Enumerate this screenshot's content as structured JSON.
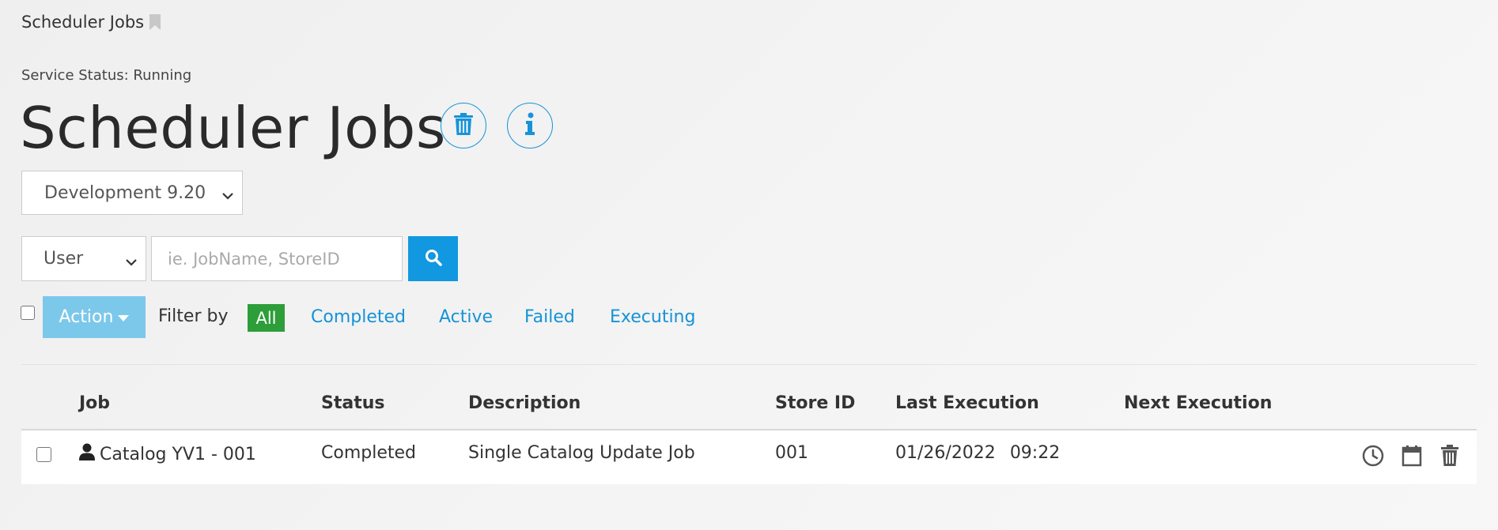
{
  "breadcrumb": {
    "title": "Scheduler Jobs"
  },
  "service_status": "Service Status: Running",
  "page_title": "Scheduler Jobs",
  "environment_select": {
    "value": "Development 9.20"
  },
  "search": {
    "type_value": "User",
    "placeholder": "ie. JobName, StoreID"
  },
  "action_button": {
    "label": "Action"
  },
  "filters": {
    "label": "Filter by",
    "all": "All",
    "completed": "Completed",
    "active": "Active",
    "failed": "Failed",
    "executing": "Executing",
    "selected_color": "#2d9e3a"
  },
  "table": {
    "headers": {
      "job": "Job",
      "status": "Status",
      "description": "Description",
      "store_id": "Store ID",
      "last_execution": "Last Execution",
      "next_execution": "Next Execution"
    },
    "rows": [
      {
        "job": "Catalog YV1 - 001",
        "status": "Completed",
        "description": "Single Catalog Update Job",
        "store_id": "001",
        "last_execution_date": "01/26/2022",
        "last_execution_time": "09:22",
        "next_execution": ""
      }
    ]
  },
  "colors": {
    "accent": "#1298e0",
    "link": "#1593d6",
    "action_button": "#7cc8ea"
  },
  "icons": {
    "breadcrumb": "bookmark-icon",
    "header_buttons": [
      "trash-icon",
      "info-icon"
    ],
    "search": "search-icon",
    "job_type": "user-icon",
    "row_actions": [
      "clock-icon",
      "calendar-icon",
      "trash-icon"
    ]
  }
}
